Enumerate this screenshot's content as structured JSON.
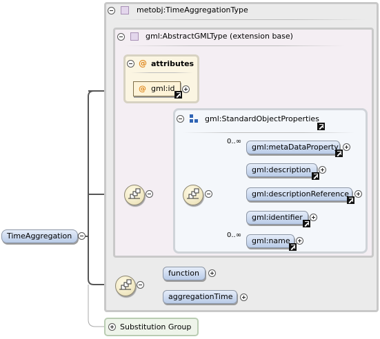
{
  "diagram": {
    "root": {
      "label": "TimeAggregation"
    },
    "type_box": {
      "title": "metobj:TimeAggregationType"
    },
    "extension": {
      "title": "gml:AbstractGMLType (extension base)"
    },
    "attributes": {
      "title": "attributes",
      "item": "gml:id"
    },
    "group": {
      "title": "gml:StandardObjectProperties"
    },
    "group_items": [
      {
        "label": "gml:metaDataProperty",
        "occurrence": "0..∞"
      },
      {
        "label": "gml:description",
        "occurrence": ""
      },
      {
        "label": "gml:descriptionReference",
        "occurrence": ""
      },
      {
        "label": "gml:identifier",
        "occurrence": ""
      },
      {
        "label": "gml:name",
        "occurrence": "0..∞"
      }
    ],
    "sequence_items": [
      {
        "label": "function"
      },
      {
        "label": "aggregationTime"
      }
    ],
    "substitution": {
      "label": "Substitution Group"
    }
  },
  "colors": {
    "node_fill": "#b9cbe8",
    "attribute_fill": "#fbf5e2",
    "extension_fill": "#f4eef3",
    "substitution_fill": "#eef4ea"
  }
}
